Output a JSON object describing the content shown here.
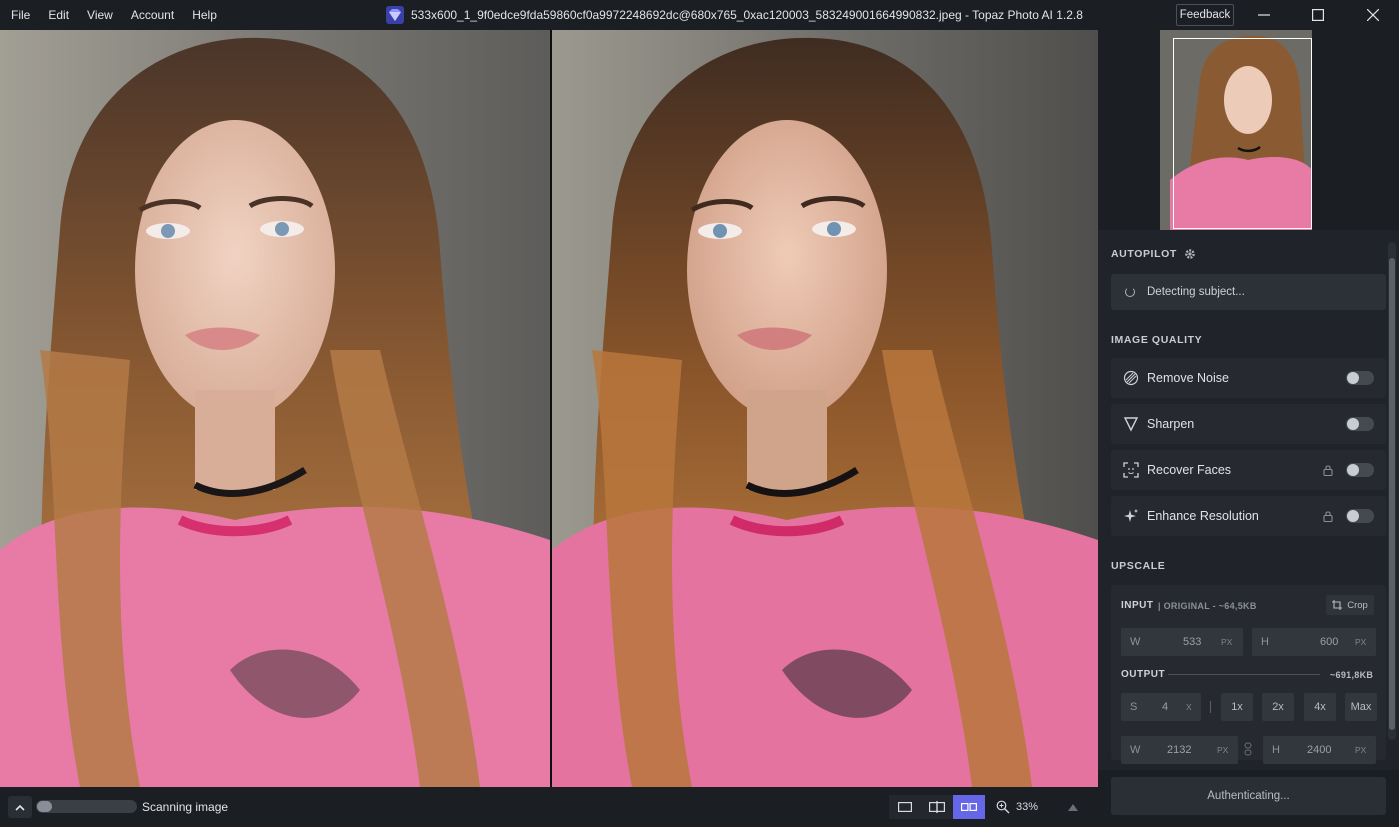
{
  "menu": [
    "File",
    "Edit",
    "View",
    "Account",
    "Help"
  ],
  "window_title": "533x600_1_9f0edce9fda59860cf0a9972248692dc@680x765_0xac120003_583249001664990832.jpeg - Topaz Photo AI 1.2.8",
  "feedback_label": "Feedback",
  "autopilot": {
    "label": "AUTOPILOT",
    "status": "Detecting subject..."
  },
  "image_quality": {
    "label": "IMAGE QUALITY",
    "features": [
      {
        "label": "Remove Noise",
        "locked": false,
        "enabled": false
      },
      {
        "label": "Sharpen",
        "locked": false,
        "enabled": false
      },
      {
        "label": "Recover Faces",
        "locked": true,
        "enabled": false
      },
      {
        "label": "Enhance Resolution",
        "locked": true,
        "enabled": false
      }
    ]
  },
  "upscale": {
    "label": "UPSCALE",
    "input_label": "INPUT",
    "input_meta": "| ORIGINAL - ~64,5KB",
    "crop_label": "Crop",
    "input_w_label": "W",
    "input_w": "533",
    "input_h_label": "H",
    "input_h": "600",
    "unit": "PX",
    "output_label": "OUTPUT",
    "output_size": "~691,8KB",
    "scale_label": "S",
    "scale_value": "4",
    "scale_unit": "X",
    "presets": [
      "1x",
      "2x",
      "4x",
      "Max"
    ],
    "output_w_label": "W",
    "output_w": "2132",
    "output_h_label": "H",
    "output_h": "2400"
  },
  "auth_button": "Authenticating...",
  "status": {
    "scan_text": "Scanning image",
    "zoom": "33%"
  },
  "colors": {
    "accent": "#6567e8",
    "panel_bg": "#202329",
    "shirt_pink": "#e77ba6"
  }
}
